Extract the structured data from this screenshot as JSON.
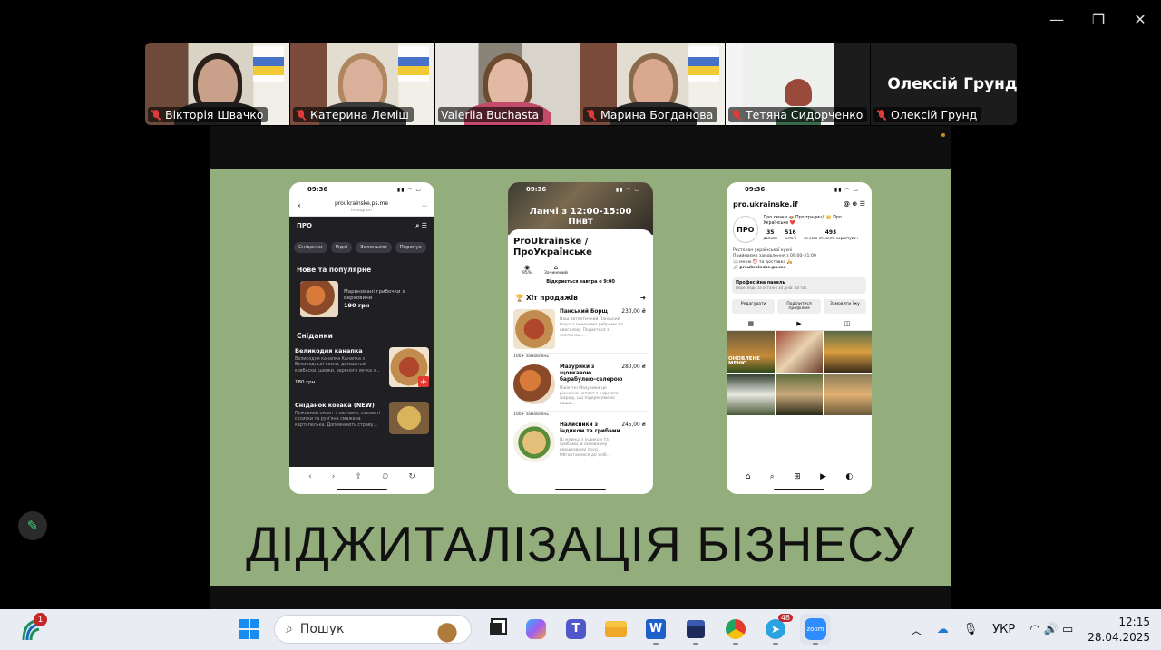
{
  "window": {
    "controls": {
      "minimize": "—",
      "restore": "❐",
      "close": "✕"
    }
  },
  "participants": [
    {
      "name": "Вікторія Швачко",
      "muted": true
    },
    {
      "name": "Катерина Леміш",
      "muted": true
    },
    {
      "name": "Valeriia Buchasta",
      "muted": false,
      "active": true
    },
    {
      "name": "Марина Богданова",
      "muted": true
    },
    {
      "name": "Тетяна Сидорченко",
      "muted": true
    },
    {
      "name": "Олексій Грунд",
      "muted": true,
      "display_name": "Олексій Грунд"
    }
  ],
  "slide": {
    "title": "ДІДЖИТАЛІЗАЦІЯ БІЗНЕСУ",
    "phone1": {
      "time": "09:36",
      "url": "proukrainske.ps.me",
      "url_sub": "instagram",
      "logo": "ПРО",
      "chips": [
        "Сніданки",
        "Рідкі",
        "Зелеными",
        "Перекус"
      ],
      "section_new": "Нове та популярне",
      "featured": {
        "name": "Мариновані грибочки з Верховини",
        "price": "190 грн"
      },
      "section_breakfast": "Сніданки",
      "items": [
        {
          "title": "Великодня канапка",
          "desc": "Великодня канапка Канапка з Великодньої паски, домашньої ковбаски, шинки, вареного яєчка з...",
          "price": "180 грн"
        },
        {
          "title": "Сніданок козака (NEW)",
          "desc": "Пожовний омлет з овочами, соковиті сосиски та рум'яна смажена картопелька. Доповнюють страву...",
          "price": ""
        }
      ],
      "nav": [
        "‹",
        "›",
        "⇧",
        "⏲",
        "↻"
      ]
    },
    "phone2": {
      "time": "09:36",
      "overlay": "Ланчі з 12:00-15:00",
      "overlay2": "Пнвт",
      "title": "ProUkrainske / ПроУкраїнське",
      "stat1_value": "95%",
      "stat2_label": "Зачинений",
      "open_text": "Відкриється завтра о 9:00",
      "hit_label": "Хіт продажів",
      "dishes": [
        {
          "name": "Панський Борщ",
          "price": "230,00 ₴",
          "desc": "Наш автентичний Панський борщ з печеними ребрами та квасолею. Подається з сметаною...",
          "orders": "100+ замовлень"
        },
        {
          "name": "Мазурики з щовкавою барабулею-селерою",
          "price": "280,00 ₴",
          "desc": "Пікантні Мазурики це різнинка котлет з індичого фаршу, що підкреслюємо ваши...",
          "orders": "100+ замовлень"
        },
        {
          "name": "Налисники з індиком та грибами",
          "price": "245,00 ₴",
          "desc": "Ці млинці з індиком та грибами, в основному вершковому соусі. Обгортаємося до хліб...",
          "orders": ""
        }
      ]
    },
    "phone3": {
      "time": "09:36",
      "handle": "pro.ukrainske.if",
      "avatar": "ПРО",
      "tagline": "Про смаки 🍲 Про традиції 👑 Про Українське ❤️",
      "stats": [
        {
          "value": "35",
          "label": "дописи"
        },
        {
          "value": "516",
          "label": "читачі"
        },
        {
          "value": "493",
          "label": "за кого стежить користувач"
        }
      ],
      "bio1": "Ресторан української кухні",
      "bio2": "Приймаємо замовлення з 09:00–21:00",
      "bio3": "📖 меню ⏰ та доставка 🛵",
      "link": "proukrainske.ps.me",
      "panel_title": "Професійна панель",
      "panel_sub": "Перегляди за останні 30 днів: 18 тис.",
      "buttons": [
        "Редагувати",
        "Поділитися профілем",
        "Замовити їжу"
      ],
      "grid_label": "ОНОВЛЕНЕ МЕНЮ"
    }
  },
  "taskbar": {
    "badge_count": "1",
    "search_placeholder": "Пошук",
    "telegram_badge": "48",
    "zoom_label": "zoom",
    "language": "УКР",
    "time": "12:15",
    "date": "28.04.2025"
  }
}
